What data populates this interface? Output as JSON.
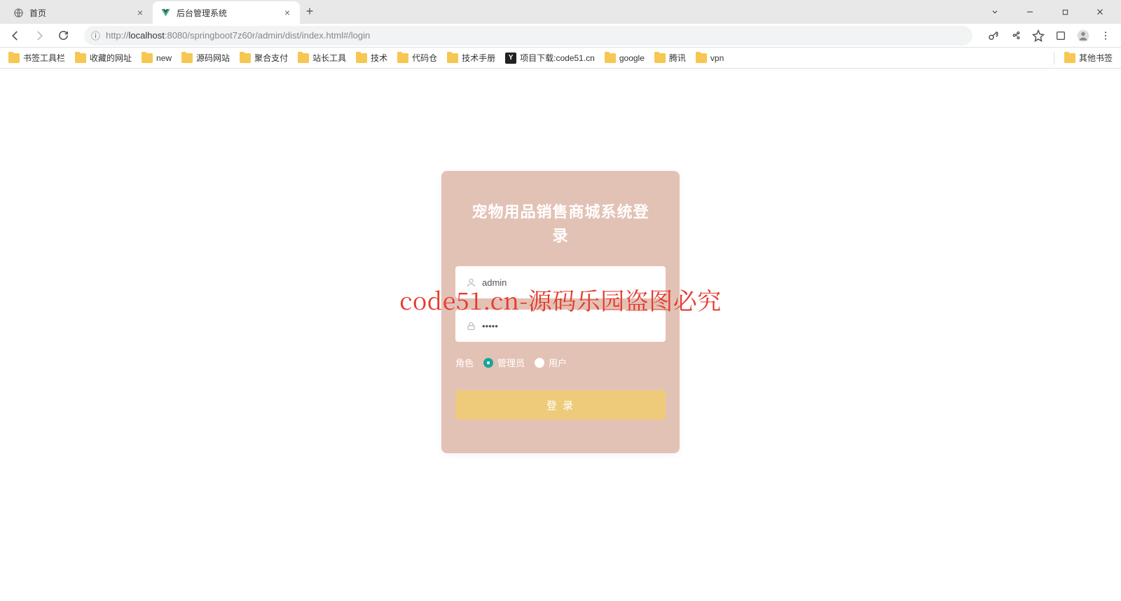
{
  "browser": {
    "tabs": [
      {
        "title": "首页",
        "active": false
      },
      {
        "title": "后台管理系统",
        "active": true
      }
    ],
    "url": {
      "protocol_icon": "ⓘ",
      "prefix": "http://",
      "host": "localhost",
      "port_path": ":8080/springboot7z60r/admin/dist/index.html#/login"
    },
    "bookmarks": [
      "书签工具栏",
      "收藏的网址",
      "new",
      "源码网站",
      "聚合支付",
      "站长工具",
      "技术",
      "代码仓",
      "技术手册"
    ],
    "bookmark_special": {
      "label": "项目下载:code51.cn"
    },
    "bookmarks2": [
      "google",
      "腾讯",
      "vpn"
    ],
    "other_bookmarks": "其他书签"
  },
  "login": {
    "title_line1": "宠物用品销售商城系统登",
    "title_line2": "录",
    "username_value": "admin",
    "password_value": "•••••",
    "role_label": "角色",
    "role_admin": "管理员",
    "role_user": "用户",
    "login_button": "登 录"
  },
  "watermark": "code51.cn-源码乐园盗图必究"
}
